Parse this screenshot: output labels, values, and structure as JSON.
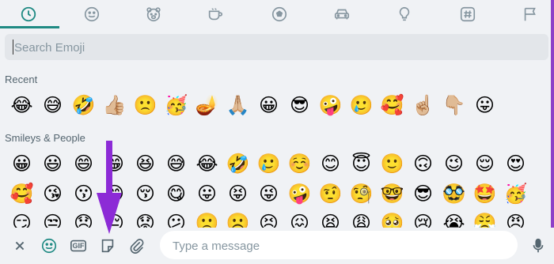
{
  "colors": {
    "accent": "#1f8a83",
    "border_purple": "#8d3fc8",
    "arrow": "#8c2bd6",
    "icon_gray": "#8696a0",
    "background": "#f0f2f5"
  },
  "category_tabs": [
    {
      "name": "recent",
      "icon": "clock-icon",
      "active": true
    },
    {
      "name": "smileys",
      "icon": "smiley-icon"
    },
    {
      "name": "animals",
      "icon": "bear-icon"
    },
    {
      "name": "food",
      "icon": "cup-icon"
    },
    {
      "name": "activity",
      "icon": "ball-icon"
    },
    {
      "name": "travel",
      "icon": "car-icon"
    },
    {
      "name": "objects",
      "icon": "lightbulb-icon"
    },
    {
      "name": "symbols",
      "icon": "hashtag-icon"
    },
    {
      "name": "flags",
      "icon": "flag-icon"
    }
  ],
  "search": {
    "placeholder": "Search Emoji",
    "value": ""
  },
  "sections": {
    "recent": "Recent",
    "smileys": "Smileys & People"
  },
  "recent_emojis": [
    "😂",
    "😅",
    "🤣",
    "👍🏼",
    "🙁",
    "🥳",
    "🪔",
    "🙏🏼",
    "😀",
    "😎",
    "🤪",
    "🥲",
    "🥰",
    "☝🏼",
    "👇🏼",
    "😛"
  ],
  "smileys_rows": [
    [
      "😀",
      "😃",
      "😄",
      "😁",
      "😆",
      "😅",
      "😂",
      "🤣",
      "🥲",
      "☺️",
      "😊",
      "😇",
      "🙂",
      "🙃",
      "😉",
      "😌",
      "😍"
    ],
    [
      "🥰",
      "😘",
      "😗",
      "😙",
      "😚",
      "😋",
      "😛",
      "😝",
      "😜",
      "🤪",
      "🤨",
      "🧐",
      "🤓",
      "😎",
      "🥸",
      "🤩",
      "🥳"
    ],
    [
      "😏",
      "😒",
      "😞",
      "😔",
      "😟",
      "😕",
      "🙁",
      "☹️",
      "😣",
      "😖",
      "😫",
      "😩",
      "🥺",
      "😢",
      "😭",
      "😤",
      "😠"
    ]
  ],
  "composer": {
    "placeholder": "Type a message",
    "value": "",
    "buttons": [
      "close-icon",
      "emoji-icon",
      "gif-icon",
      "sticker-icon",
      "attach-icon",
      "mic-icon"
    ],
    "gif_label": "GIF"
  }
}
